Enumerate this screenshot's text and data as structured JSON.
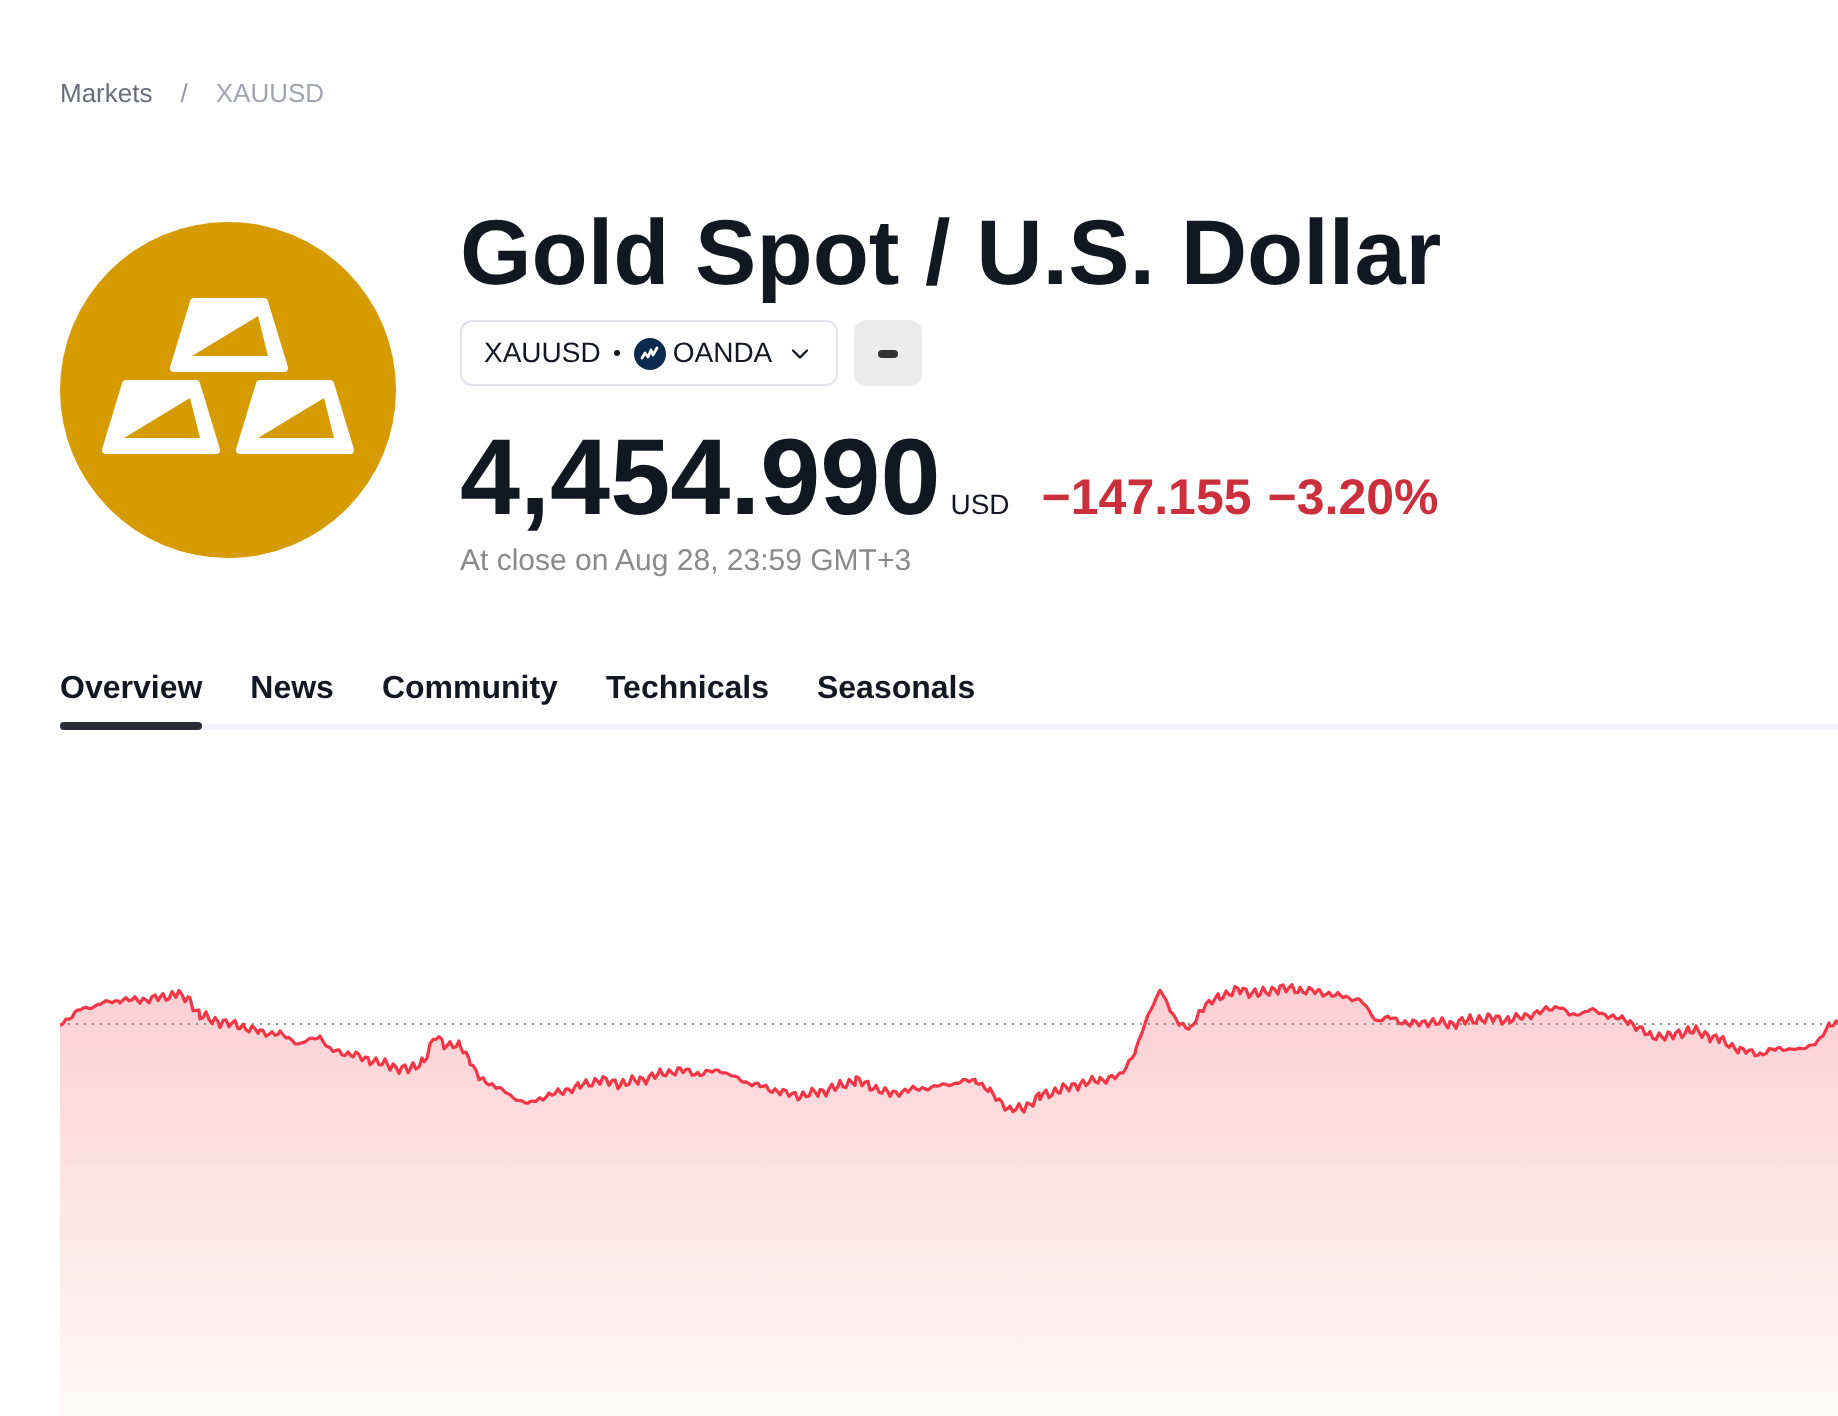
{
  "breadcrumb": {
    "items": [
      {
        "label": "Markets"
      },
      {
        "label": "XAUUSD"
      }
    ],
    "separator": "/"
  },
  "header": {
    "title": "Gold Spot / U.S. Dollar",
    "symbol": "XAUUSD",
    "exchange": "OANDA"
  },
  "quote": {
    "price": "4,454.990",
    "currency": "USD",
    "change": "−147.155",
    "change_percent": "−3.20%",
    "falling": true,
    "status": "At close on Aug 28, 23:59 GMT+3"
  },
  "tabs": [
    {
      "label": "Overview",
      "selected": true
    },
    {
      "label": "News",
      "selected": false
    },
    {
      "label": "Community",
      "selected": false
    },
    {
      "label": "Technicals",
      "selected": false
    },
    {
      "label": "Seasonals",
      "selected": false
    }
  ]
}
